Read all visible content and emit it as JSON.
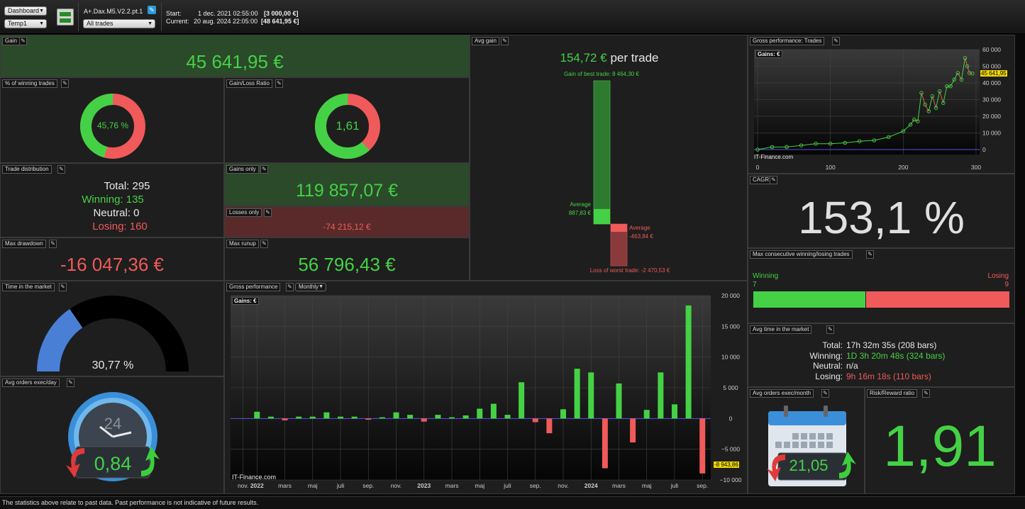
{
  "toolbar": {
    "dashboard_select": "Dashboard",
    "template_select": "Temp1",
    "strategy_name": "A+.Dax.M5.V2.2.pt.1",
    "trades_filter": "All trades",
    "start_label": "Start:",
    "start_date": "1 dec. 2021 02:55:00",
    "start_value": "[3 000,00 €]",
    "current_label": "Current:",
    "current_date": "20 aug. 2024 22:05:00",
    "current_value": "[48 641,95 €]"
  },
  "gain": {
    "title": "Gain",
    "value": "45 641,95 €"
  },
  "winning_pct": {
    "title": "% of winning trades",
    "value": "45,76 %",
    "fraction": 0.4576
  },
  "gain_loss_ratio": {
    "title": "Gain/Loss Ratio",
    "value": "1,61",
    "fraction": 0.617
  },
  "trade_distribution": {
    "title": "Trade distribution",
    "total": "Total: 295",
    "winning": "Winning: 135",
    "neutral": "Neutral: 0",
    "losing": "Losing: 160"
  },
  "gains_only": {
    "title": "Gains only",
    "value": "119 857,07 €"
  },
  "losses_only": {
    "title": "Losses only",
    "value": "-74 215,12 €"
  },
  "max_drawdown": {
    "title": "Max drawdown",
    "value": "-16 047,36 €"
  },
  "max_runup": {
    "title": "Max runup",
    "value": "56 796,43 €"
  },
  "avg_gain": {
    "title": "Avg gain",
    "value": "154,72 €",
    "suffix": "per trade",
    "best_label": "Gain of best trade: 8 464,30 €",
    "worst_label": "Loss of worst trade: -2 470,53 €",
    "avg_win_label": "Average",
    "avg_win_value": "887,83 €",
    "avg_loss_label": "Average",
    "avg_loss_value": "-463,84 €",
    "best": 8464.3,
    "avg_win": 887.83,
    "worst": -2470.53,
    "avg_loss": -463.84
  },
  "time_in_market": {
    "title": "Time in the market",
    "value": "30,77 %",
    "fraction": 0.3077
  },
  "avg_orders_day": {
    "title": "Avg orders exec/day",
    "value": "0,84",
    "clock_label": "24"
  },
  "gross_perf": {
    "title": "Gross performance",
    "period_select": "Monthly",
    "chart_label": "Gains: €",
    "credit": "IT-Finance.com",
    "last_value_label": "-8 943,86"
  },
  "gross_trades": {
    "title": "Gross performance: Trades",
    "chart_label": "Gains: €",
    "credit": "IT-Finance.com",
    "last_value_label": "45 641,95"
  },
  "cagr": {
    "title": "CAGR",
    "value": "153,1 %"
  },
  "max_consecutive": {
    "title": "Max consecutive winning/losing trades",
    "winning_label": "Winning",
    "winning_value": "7",
    "losing_label": "Losing",
    "losing_value": "9",
    "winning": 7,
    "losing": 9
  },
  "avg_time_market": {
    "title": "Avg time in the market",
    "total_label": "Total:",
    "total_value": "17h 32m 35s (208 bars)",
    "winning_label": "Winning:",
    "winning_value": "1D 3h 20m 48s (324 bars)",
    "neutral_label": "Neutral:",
    "neutral_value": "n/a",
    "losing_label": "Losing:",
    "losing_value": "9h 16m 18s (110 bars)"
  },
  "avg_orders_month": {
    "title": "Avg orders exec/month",
    "value": "21,05"
  },
  "risk_reward": {
    "title": "Risk/Reward ratio",
    "value": "1,91"
  },
  "footer": "The statistics above relate to past data. Past performance is not indicative of future results.",
  "colors": {
    "green": "#45d145",
    "red": "#f05a5a",
    "blue": "#4a7fd6",
    "panel": "#1e1e1e"
  },
  "chart_data": [
    {
      "type": "bar",
      "title": "Gross performance",
      "ylabel": "Gains: €",
      "ylim": [
        -10000,
        20000
      ],
      "yticks": [
        20000,
        15000,
        10000,
        5000,
        0,
        -5000,
        -10000
      ],
      "ytick_labels": [
        "20 000",
        "15 000",
        "10 000",
        "5 000",
        "0",
        "−5 000",
        "−10 000"
      ],
      "xtick_labels": [
        {
          "i": 0,
          "label": "nov.",
          "bold": false
        },
        {
          "i": 1,
          "label": "2022",
          "bold": true
        },
        {
          "i": 3,
          "label": "mars",
          "bold": false
        },
        {
          "i": 5,
          "label": "maj",
          "bold": false
        },
        {
          "i": 7,
          "label": "juli",
          "bold": false
        },
        {
          "i": 9,
          "label": "sep.",
          "bold": false
        },
        {
          "i": 11,
          "label": "nov.",
          "bold": false
        },
        {
          "i": 13,
          "label": "2023",
          "bold": true
        },
        {
          "i": 15,
          "label": "mars",
          "bold": false
        },
        {
          "i": 17,
          "label": "maj",
          "bold": false
        },
        {
          "i": 19,
          "label": "juli",
          "bold": false
        },
        {
          "i": 21,
          "label": "sep.",
          "bold": false
        },
        {
          "i": 23,
          "label": "nov.",
          "bold": false
        },
        {
          "i": 25,
          "label": "2024",
          "bold": true
        },
        {
          "i": 27,
          "label": "mars",
          "bold": false
        },
        {
          "i": 29,
          "label": "maj",
          "bold": false
        },
        {
          "i": 31,
          "label": "juli",
          "bold": false
        },
        {
          "i": 33,
          "label": "sep.",
          "bold": false
        }
      ],
      "series": [
        {
          "values": [
            0,
            1100,
            300,
            -300,
            300,
            300,
            1000,
            300,
            300,
            -200,
            200,
            1000,
            600,
            -500,
            600,
            200,
            500,
            1600,
            2400,
            600,
            5900,
            -600,
            -2400,
            1500,
            8100,
            7500,
            -8100,
            5700,
            -3900,
            1400,
            7500,
            2300,
            18400,
            -8944
          ]
        }
      ]
    },
    {
      "type": "line",
      "title": "Gross performance: Trades",
      "ylabel": "Gains: €",
      "xlim": [
        0,
        300
      ],
      "ylim": [
        -3000,
        60000
      ],
      "xticks": [
        0,
        100,
        200,
        300
      ],
      "yticks": [
        60000,
        50000,
        40000,
        30000,
        20000,
        10000,
        0
      ],
      "ytick_labels": [
        "60 000",
        "50 000",
        "40 000",
        "30 000",
        "20 000",
        "10 000",
        "0"
      ],
      "series": [
        {
          "x": [
            0,
            20,
            40,
            60,
            80,
            100,
            120,
            140,
            160,
            180,
            200,
            210,
            215,
            220,
            225,
            230,
            235,
            240,
            245,
            250,
            255,
            260,
            265,
            270,
            275,
            280,
            285,
            288,
            291,
            295
          ],
          "y": [
            0,
            1500,
            1500,
            2500,
            3500,
            3500,
            4000,
            5000,
            5500,
            7500,
            11000,
            15000,
            18000,
            17000,
            34000,
            27000,
            23000,
            32000,
            25000,
            35000,
            28000,
            38000,
            38000,
            42000,
            46000,
            42000,
            55000,
            50000,
            46000,
            45642
          ]
        }
      ]
    }
  ]
}
